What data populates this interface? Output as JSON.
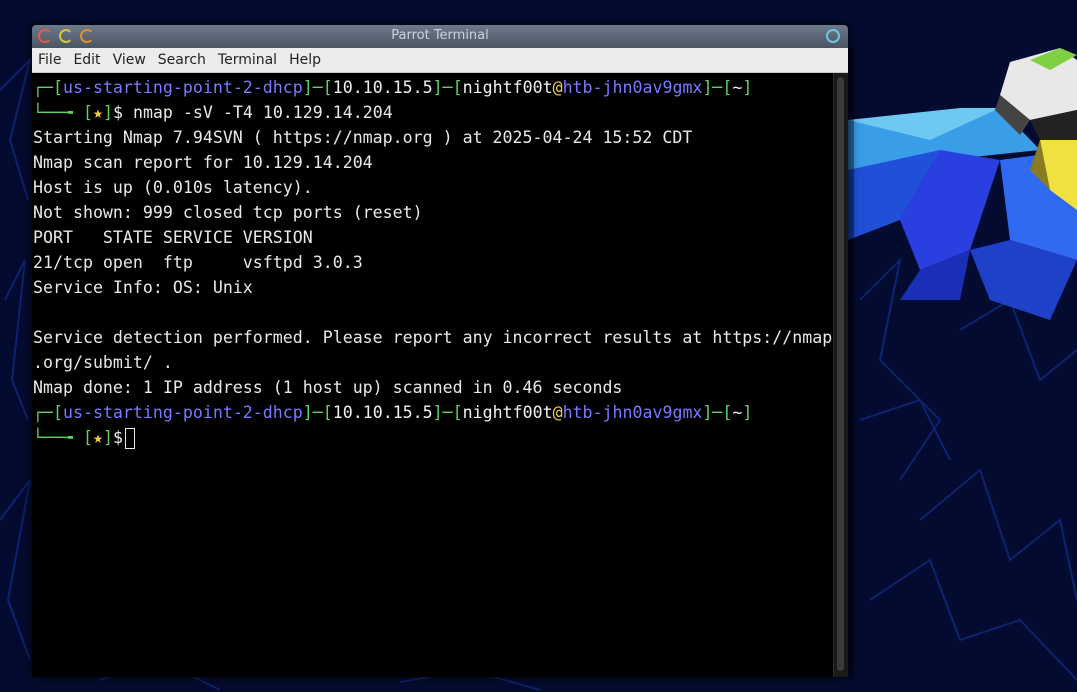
{
  "window": {
    "title": "Parrot Terminal",
    "menu": [
      "File",
      "Edit",
      "View",
      "Search",
      "Terminal",
      "Help"
    ]
  },
  "prompt": {
    "context": "us-starting-point-2-dhcp",
    "ip": "10.10.15.5",
    "user": "nightf00t",
    "at": "@",
    "host": "htb-jhn0av9gmx",
    "dir": "~",
    "star": "★",
    "symbol": "$"
  },
  "command": "nmap -sV -T4 10.129.14.204",
  "output": [
    "Starting Nmap 7.94SVN ( https://nmap.org ) at 2025-04-24 15:52 CDT",
    "Nmap scan report for 10.129.14.204",
    "Host is up (0.010s latency).",
    "Not shown: 999 closed tcp ports (reset)",
    "PORT   STATE SERVICE VERSION",
    "21/tcp open  ftp     vsftpd 3.0.3",
    "Service Info: OS: Unix",
    "",
    "Service detection performed. Please report any incorrect results at https://nmap",
    ".org/submit/ .",
    "Nmap done: 1 IP address (1 host up) scanned in 0.46 seconds"
  ],
  "colors": {
    "prompt_bracket": "#5fd35f",
    "prompt_blue": "#7979ff",
    "terminal_bg": "#000000",
    "terminal_fg": "#e8e8e8"
  }
}
